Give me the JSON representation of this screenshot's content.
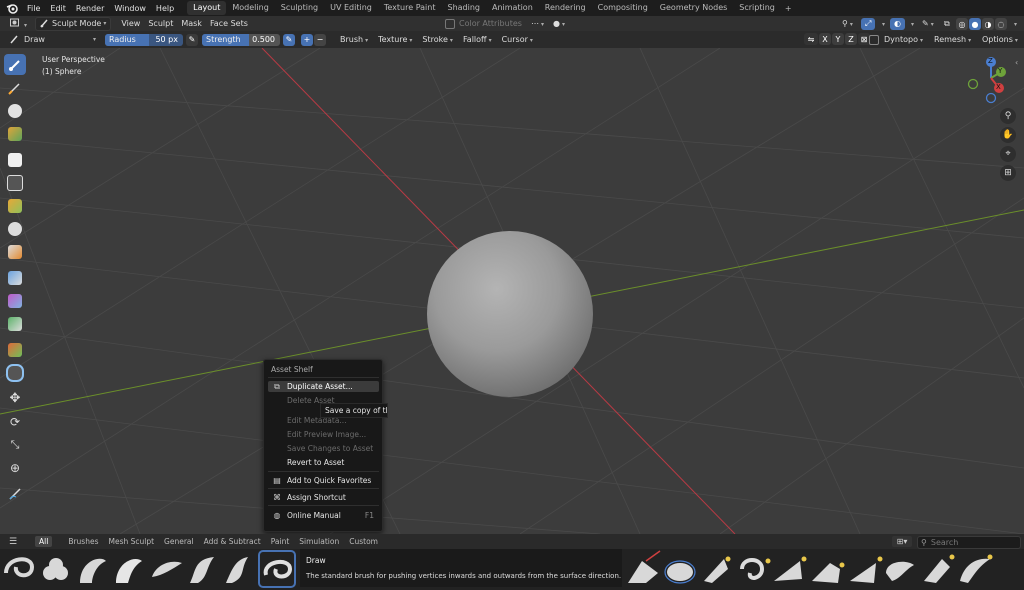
{
  "menubar": {
    "items": [
      "File",
      "Edit",
      "Render",
      "Window",
      "Help"
    ],
    "workspaces": [
      "Layout",
      "Modeling",
      "Sculpting",
      "UV Editing",
      "Texture Paint",
      "Shading",
      "Animation",
      "Rendering",
      "Compositing",
      "Geometry Nodes",
      "Scripting"
    ],
    "active_workspace": "Layout",
    "add_icon": "+"
  },
  "header": {
    "mode": "Sculpt Mode",
    "menus": [
      "View",
      "Sculpt",
      "Mask",
      "Face Sets"
    ],
    "color_attributes": "Color Attributes"
  },
  "tool_settings": {
    "brush": "Draw",
    "radius_label": "Radius",
    "radius_value": "50 px",
    "strength_label": "Strength",
    "strength_value": "0.500",
    "plus": "+",
    "minus": "−",
    "menus": [
      "Brush",
      "Texture",
      "Stroke",
      "Falloff",
      "Cursor"
    ],
    "axes": [
      "X",
      "Y",
      "Z"
    ],
    "dyntopo": "Dyntopo",
    "remesh": "Remesh",
    "options": "Options"
  },
  "viewport": {
    "perspective": "User Perspective",
    "object": "(1) Sphere",
    "gizmo": {
      "z": "Z",
      "y": "Y",
      "x": "X"
    }
  },
  "context_menu": {
    "title": "Asset Shelf",
    "items": [
      {
        "label": "Duplicate Asset...",
        "enabled": true,
        "highlighted": true,
        "icon": "duplicate-icon"
      },
      {
        "label": "Delete Asset",
        "enabled": false
      },
      {
        "label": "Edit Metadata...",
        "enabled": false
      },
      {
        "label": "Edit Preview Image...",
        "enabled": false
      },
      {
        "label": "Save Changes to Asset",
        "enabled": false
      },
      {
        "label": "Revert to Asset",
        "enabled": true
      },
      {
        "label": "Add to Quick Favorites",
        "enabled": true,
        "icon": "favorites-icon"
      },
      {
        "label": "Assign Shortcut",
        "enabled": true,
        "icon": "shortcut-icon"
      },
      {
        "label": "Online Manual",
        "enabled": true,
        "icon": "manual-icon",
        "shortcut": "F1"
      }
    ]
  },
  "tooltip": "Save a copy of th",
  "asset_shelf": {
    "categories": [
      "All",
      "Brushes",
      "Mesh Sculpt",
      "General",
      "Add & Subtract",
      "Paint",
      "Simulation",
      "Custom"
    ],
    "active_category": "All",
    "search_placeholder": "Search",
    "selected_brush_name": "Draw",
    "selected_brush_desc": "The standard brush for pushing vertices inwards and outwards from the surface direction."
  },
  "colors": {
    "accent": "#4772b3",
    "x_axis": "#c4404a",
    "y_axis": "#7da62e"
  }
}
